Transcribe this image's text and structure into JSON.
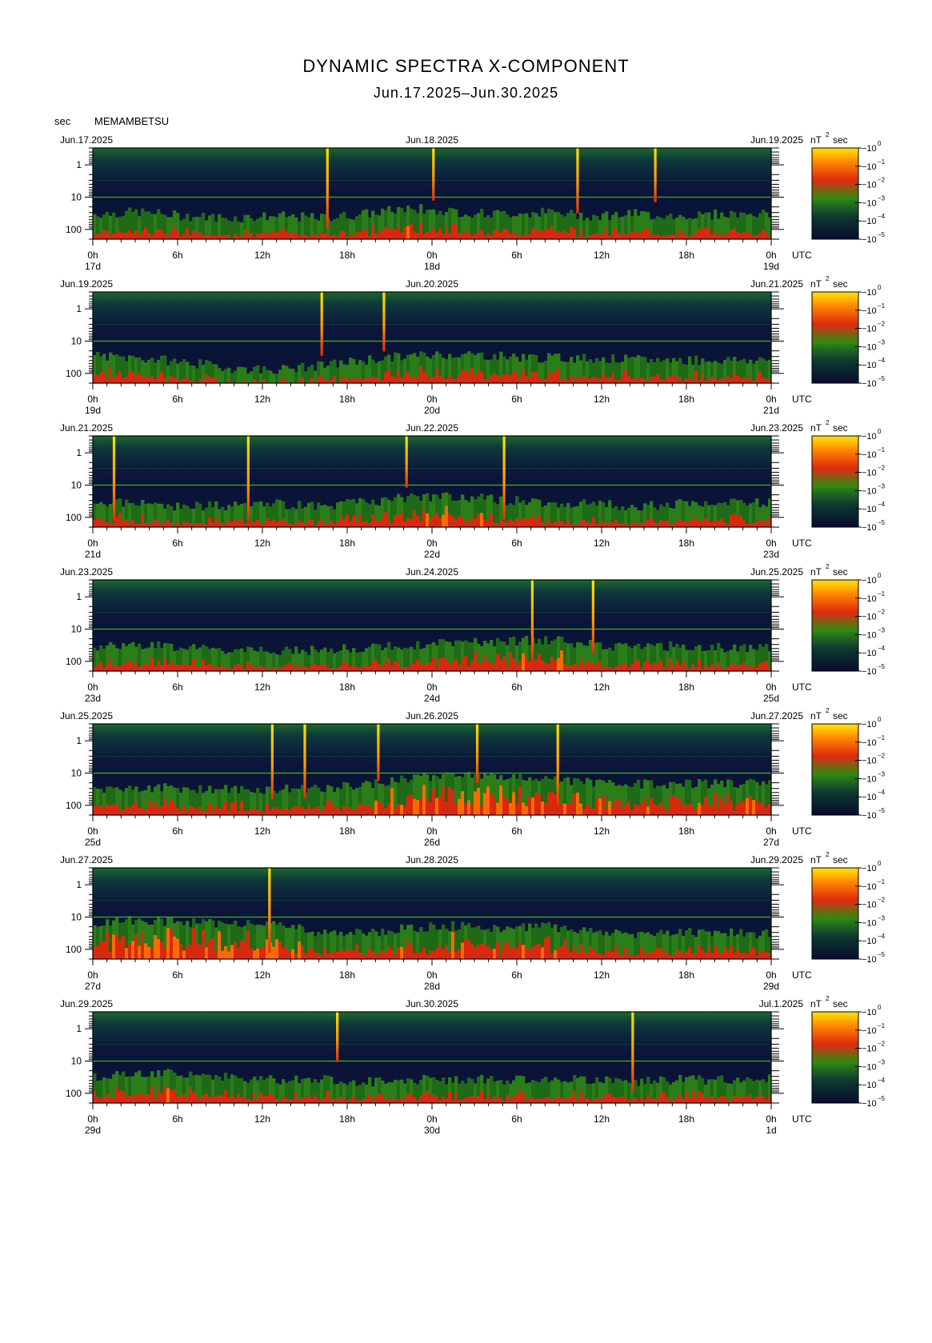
{
  "title": "DYNAMIC SPECTRA X-COMPONENT",
  "subtitle": "Jun.17.2025–Jun.30.2025",
  "y_unit_label": "sec",
  "station": "MEMAMBETSU",
  "colorbar_unit": "nT",
  "colorbar_unit_exp": "2",
  "colorbar_unit_suffix": "sec",
  "utc_label": "UTC",
  "x_tick_labels": [
    "0h",
    "6h",
    "12h",
    "18h",
    "0h",
    "6h",
    "12h",
    "18h",
    "0h"
  ],
  "y_tick_labels": [
    "1",
    "10",
    "100"
  ],
  "colorbar_ticks": [
    {
      "base": "10",
      "exp": "0"
    },
    {
      "base": "10",
      "exp": "−1"
    },
    {
      "base": "10",
      "exp": "−2"
    },
    {
      "base": "10",
      "exp": "−3"
    },
    {
      "base": "10",
      "exp": "−4"
    },
    {
      "base": "10",
      "exp": "−5"
    }
  ],
  "colors": {
    "colormap": [
      "#0a0a30",
      "#0c2a40",
      "#116e1d",
      "#2e8a12",
      "#e03010",
      "#ff8a00",
      "#ffe600"
    ],
    "line": "#000000"
  },
  "chart_data": [
    {
      "type": "heatmap",
      "date_left": "Jun.17.2025",
      "date_mid": "Jun.18.2025",
      "date_right": "Jun.19.2025",
      "day_left": "17d",
      "day_mid": "18d",
      "day_right": "19d",
      "ylim": [
        0.3,
        200
      ],
      "yscale": "log",
      "xlim_hours": [
        0,
        48
      ],
      "bursts_hours": [
        16.6,
        24.1,
        34.3,
        39.8
      ],
      "activity": [
        0.55,
        0.6,
        0.5,
        0.45,
        0.5,
        0.45,
        0.55,
        0.7,
        0.6,
        0.55,
        0.6,
        0.5,
        0.55,
        0.5,
        0.55,
        0.55
      ]
    },
    {
      "type": "heatmap",
      "date_left": "Jun.19.2025",
      "date_mid": "Jun.20.2025",
      "date_right": "Jun.21.2025",
      "day_left": "19d",
      "day_mid": "20d",
      "day_right": "21d",
      "ylim": [
        0.3,
        200
      ],
      "yscale": "log",
      "xlim_hours": [
        0,
        48
      ],
      "bursts_hours": [
        16.2,
        20.6
      ],
      "activity": [
        0.6,
        0.55,
        0.45,
        0.3,
        0.25,
        0.35,
        0.5,
        0.6,
        0.65,
        0.6,
        0.55,
        0.55,
        0.5,
        0.5,
        0.5,
        0.5
      ]
    },
    {
      "type": "heatmap",
      "date_left": "Jun.21.2025",
      "date_mid": "Jun.22.2025",
      "date_right": "Jun.23.2025",
      "day_left": "21d",
      "day_mid": "22d",
      "day_right": "23d",
      "ylim": [
        0.3,
        200
      ],
      "yscale": "log",
      "xlim_hours": [
        0,
        48
      ],
      "bursts_hours": [
        1.5,
        11.0,
        22.2,
        29.1
      ],
      "activity": [
        0.55,
        0.5,
        0.45,
        0.45,
        0.5,
        0.45,
        0.55,
        0.65,
        0.7,
        0.6,
        0.55,
        0.5,
        0.45,
        0.5,
        0.5,
        0.55
      ]
    },
    {
      "type": "heatmap",
      "date_left": "Jun.23.2025",
      "date_mid": "Jun.24.2025",
      "date_right": "Jun.25.2025",
      "day_left": "23d",
      "day_mid": "24d",
      "day_right": "25d",
      "ylim": [
        0.3,
        200
      ],
      "yscale": "log",
      "xlim_hours": [
        0,
        48
      ],
      "bursts_hours": [
        31.1,
        35.4
      ],
      "activity": [
        0.55,
        0.6,
        0.5,
        0.45,
        0.4,
        0.45,
        0.5,
        0.55,
        0.65,
        0.65,
        0.7,
        0.6,
        0.5,
        0.55,
        0.5,
        0.5
      ]
    },
    {
      "type": "heatmap",
      "date_left": "Jun.25.2025",
      "date_mid": "Jun.26.2025",
      "date_right": "Jun.27.2025",
      "day_left": "25d",
      "day_mid": "26d",
      "day_right": "27d",
      "ylim": [
        0.3,
        200
      ],
      "yscale": "log",
      "xlim_hours": [
        0,
        48
      ],
      "bursts_hours": [
        12.7,
        15.0,
        20.2,
        27.2,
        32.9
      ],
      "activity": [
        0.6,
        0.6,
        0.6,
        0.55,
        0.55,
        0.6,
        0.65,
        0.85,
        0.9,
        0.9,
        0.85,
        0.75,
        0.7,
        0.7,
        0.7,
        0.75
      ]
    },
    {
      "type": "heatmap",
      "date_left": "Jun.27.2025",
      "date_mid": "Jun.28.2025",
      "date_right": "Jun.29.2025",
      "day_left": "27d",
      "day_mid": "28d",
      "day_right": "29d",
      "ylim": [
        0.3,
        200
      ],
      "yscale": "log",
      "xlim_hours": [
        0,
        48
      ],
      "bursts_hours": [
        12.5
      ],
      "activity": [
        0.85,
        0.9,
        0.85,
        0.8,
        0.75,
        0.6,
        0.55,
        0.7,
        0.75,
        0.7,
        0.75,
        0.6,
        0.55,
        0.6,
        0.6,
        0.55
      ]
    },
    {
      "type": "heatmap",
      "date_left": "Jun.29.2025",
      "date_mid": "Jun.30.2025",
      "date_right": "Jul.1.2025",
      "day_left": "29d",
      "day_mid": "30d",
      "day_right": "1d",
      "ylim": [
        0.3,
        200
      ],
      "yscale": "log",
      "xlim_hours": [
        0,
        48
      ],
      "bursts_hours": [
        17.3,
        38.2
      ],
      "activity": [
        0.55,
        0.7,
        0.65,
        0.55,
        0.5,
        0.5,
        0.45,
        0.5,
        0.5,
        0.5,
        0.5,
        0.5,
        0.45,
        0.5,
        0.5,
        0.55
      ]
    }
  ]
}
